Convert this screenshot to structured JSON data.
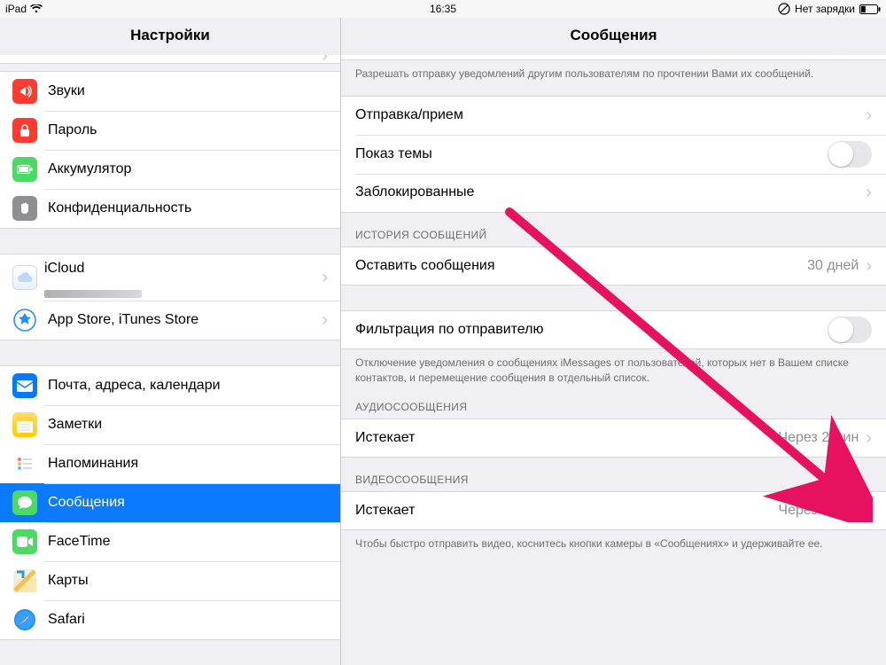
{
  "status": {
    "device": "iPad",
    "time": "16:35",
    "right": "Нет зарядки"
  },
  "sidebar": {
    "title": "Настройки",
    "items": [
      {
        "label": "Звуки"
      },
      {
        "label": "Пароль"
      },
      {
        "label": "Аккумулятор"
      },
      {
        "label": "Конфиденциальность"
      },
      {
        "label": "iCloud"
      },
      {
        "label": "App Store, iTunes Store"
      },
      {
        "label": "Почта, адреса, календари"
      },
      {
        "label": "Заметки"
      },
      {
        "label": "Напоминания"
      },
      {
        "label": "Сообщения"
      },
      {
        "label": "FaceTime"
      },
      {
        "label": "Карты"
      },
      {
        "label": "Safari"
      }
    ]
  },
  "detail": {
    "title": "Сообщения",
    "readReceiptsFooter": "Разрешать отправку уведомлений другим пользователям по прочтении Вами их сообщений.",
    "sendReceive": "Отправка/прием",
    "showSubject": "Показ темы",
    "blocked": "Заблокированные",
    "historyHeader": "ИСТОРИЯ СООБЩЕНИЙ",
    "keepMessages": "Оставить сообщения",
    "keepMessagesValue": "30 дней",
    "filterSender": "Фильтрация по отправителю",
    "filterFooter": "Отключение уведомления о сообщениях iMessages от пользователей, которых нет в Вашем списке контактов, и перемещение сообщения  в отдельный список.",
    "audioHeader": "АУДИОСООБЩЕНИЯ",
    "audioExpire": "Истекает",
    "audioExpireValue": "Через 2 мин",
    "videoHeader": "ВИДЕОСООБЩЕНИЯ",
    "videoExpire": "Истекает",
    "videoExpireValue": "Через 2 мин",
    "videoFooter": "Чтобы быстро отправить видео, коснитесь кнопки камеры в «Сообщениях» и удерживайте ее."
  }
}
